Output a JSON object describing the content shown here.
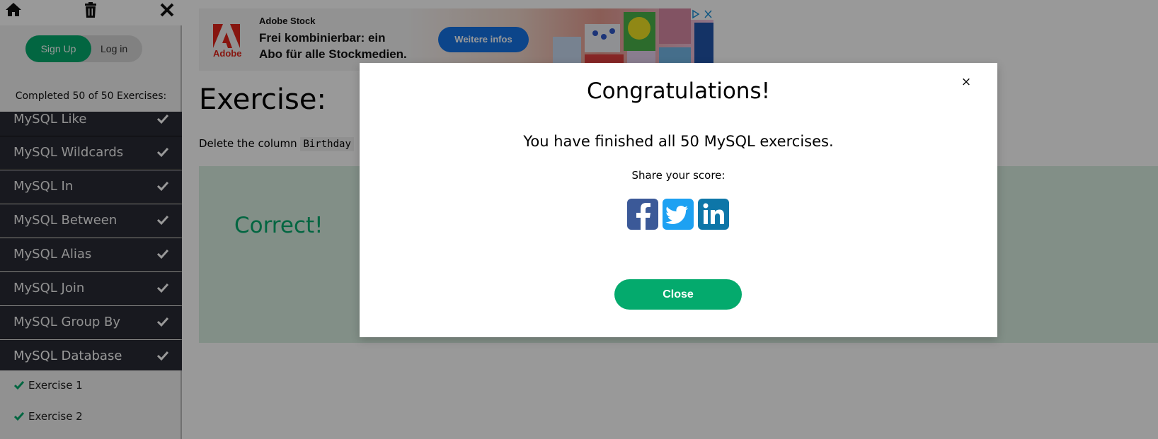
{
  "sidebar": {
    "topbar_icons": [
      "home-icon",
      "trash-icon",
      "close-icon"
    ],
    "signup_label": "Sign Up",
    "login_label": "Log in",
    "progress_text": "Completed 50 of 50 Exercises:",
    "topics": [
      {
        "label": "MySQL Like",
        "done": true
      },
      {
        "label": "MySQL Wildcards",
        "done": true
      },
      {
        "label": "MySQL In",
        "done": true
      },
      {
        "label": "MySQL Between",
        "done": true
      },
      {
        "label": "MySQL Alias",
        "done": true
      },
      {
        "label": "MySQL Join",
        "done": true
      },
      {
        "label": "MySQL Group By",
        "done": true
      },
      {
        "label": "MySQL Database",
        "done": true
      }
    ],
    "exercises": [
      {
        "label": "Exercise 1",
        "done": true
      },
      {
        "label": "Exercise 2",
        "done": true
      }
    ]
  },
  "ad": {
    "brand": "Adobe",
    "header": "Adobe Stock",
    "line1": "Frei kombinierbar: ein",
    "line2": "Abo für alle Stockmedien.",
    "cta": "Weitere infos"
  },
  "main": {
    "title": "Exercise:",
    "desc_prefix": "Delete the column",
    "desc_code": "Birthday",
    "result": "Correct!"
  },
  "modal": {
    "title": "Congratulations!",
    "message": "You have finished all 50 MySQL exercises.",
    "share_label": "Share your score:",
    "share_icons": [
      "facebook-icon",
      "twitter-icon",
      "linkedin-icon"
    ],
    "close_label": "Close",
    "close_x": "×"
  },
  "colors": {
    "accent": "#04aa6d",
    "sidebar_dark": "#282a35",
    "facebook": "#3b5998",
    "twitter": "#1da1f2",
    "linkedin": "#0e76a8"
  }
}
